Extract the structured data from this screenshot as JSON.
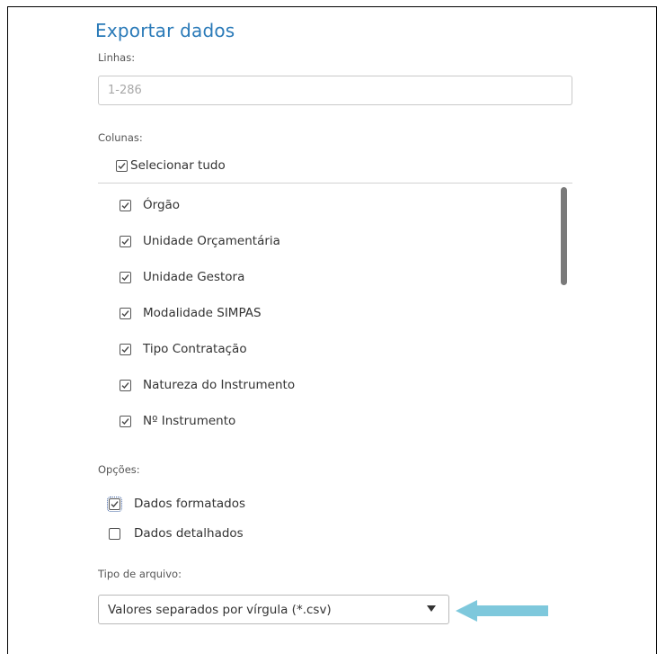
{
  "dialog": {
    "title": "Exportar dados"
  },
  "rows": {
    "label": "Linhas:",
    "placeholder": "1-286"
  },
  "columns": {
    "label": "Colunas:",
    "select_all_label": "Selecionar tudo",
    "select_all_checked": true,
    "items": [
      {
        "label": "Órgão",
        "checked": true
      },
      {
        "label": "Unidade Orçamentária",
        "checked": true
      },
      {
        "label": "Unidade Gestora",
        "checked": true
      },
      {
        "label": "Modalidade SIMPAS",
        "checked": true
      },
      {
        "label": "Tipo Contratação",
        "checked": true
      },
      {
        "label": "Natureza do Instrumento",
        "checked": true
      },
      {
        "label": "Nº Instrumento",
        "checked": true
      }
    ]
  },
  "options": {
    "label": "Opções:",
    "formatted_label": "Dados formatados",
    "formatted_checked": true,
    "detailed_label": "Dados detalhados",
    "detailed_checked": false
  },
  "file_type": {
    "label": "Tipo de arquivo:",
    "selected": "Valores separados por vírgula (*.csv)"
  },
  "colors": {
    "title": "#2a7ab8",
    "annotation_arrow": "#7ec8dc"
  }
}
